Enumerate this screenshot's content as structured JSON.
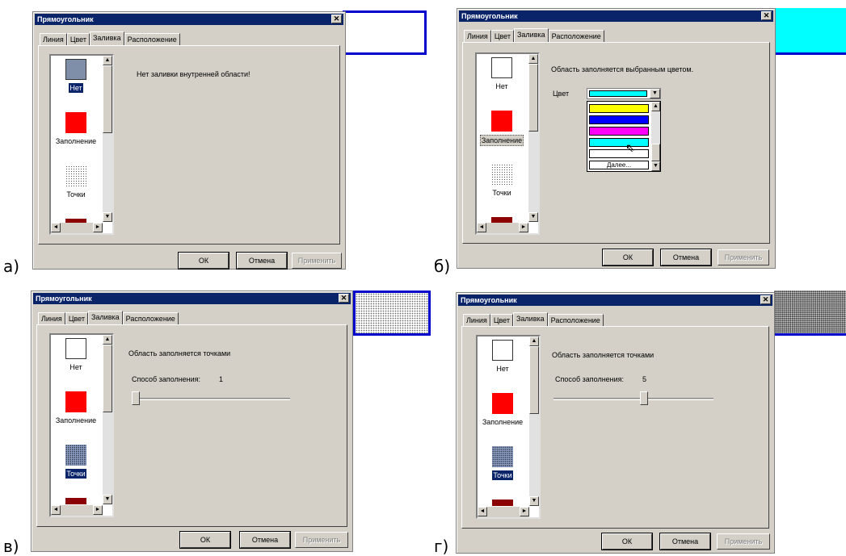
{
  "dialog_title": "Прямоугольник",
  "close_glyph": "✕",
  "tabs": [
    "Линия",
    "Цвет",
    "Заливка",
    "Расположение"
  ],
  "list_items": {
    "none": "Нет",
    "fill": "Заполнение",
    "dots": "Точки"
  },
  "buttons": {
    "ok": "ОК",
    "cancel": "Отмена",
    "apply": "Применить"
  },
  "panels": {
    "a": {
      "label": "а)",
      "description": "Нет заливки внутренней области!",
      "selected_item": "Нет"
    },
    "b": {
      "label": "б)",
      "description": "Область заполняется выбранным цветом.",
      "color_label": "Цвет",
      "color_value": "#00ffff",
      "dropdown_colors": [
        "#ffff00",
        "#0000ff",
        "#ff00ff",
        "#00ffff",
        "#ffffff"
      ],
      "dropdown_more": "Далее..."
    },
    "c": {
      "label": "в)",
      "description": "Область заполняется точками",
      "method_label": "Способ заполнения:",
      "method_value": "1",
      "slider_fraction": 0.0
    },
    "d": {
      "label": "г)",
      "description": "Область заполняется точками",
      "method_label": "Способ заполнения:",
      "method_value": "5",
      "slider_fraction": 0.57
    }
  }
}
